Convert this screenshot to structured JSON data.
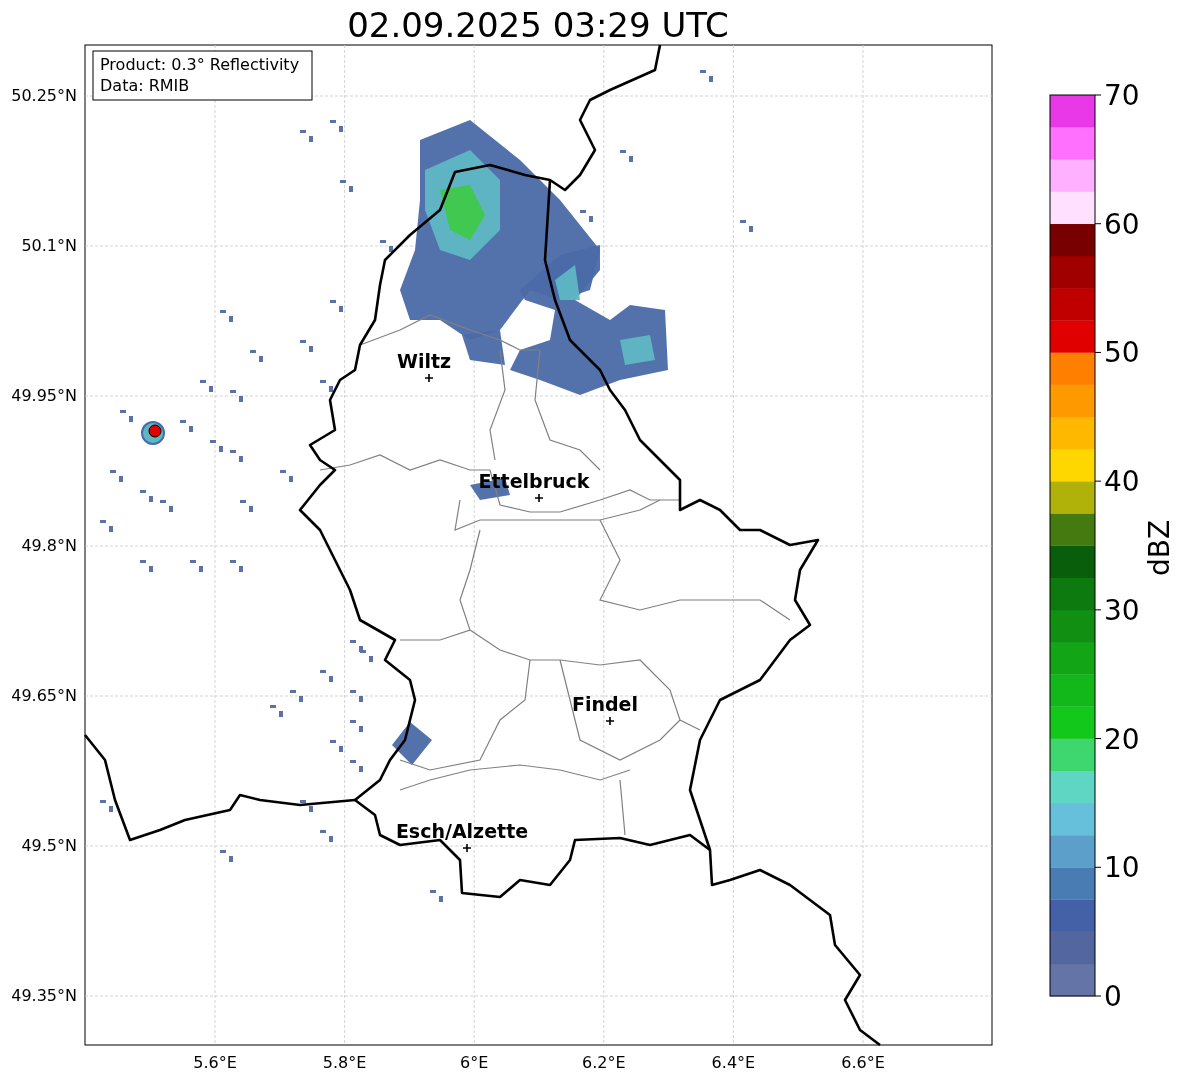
{
  "title": "02.09.2025 03:29 UTC",
  "info_box": [
    "Product: 0.3° Reflectivity",
    "Data: RMIB"
  ],
  "map": {
    "y_ticks": [
      "50.25°N",
      "50.1°N",
      "49.95°N",
      "49.8°N",
      "49.65°N",
      "49.5°N",
      "49.35°N"
    ],
    "x_ticks": [
      "5.6°E",
      "5.8°E",
      "6°E",
      "6.2°E",
      "6.4°E",
      "6.6°E"
    ],
    "cities": [
      {
        "name": "Wiltz"
      },
      {
        "name": "Ettelbruck"
      },
      {
        "name": "Findel"
      },
      {
        "name": "Esch/Alzette"
      }
    ]
  },
  "colorbar": {
    "label": "dBZ",
    "ticks": [
      "70",
      "60",
      "50",
      "40",
      "30",
      "20",
      "10",
      "0"
    ],
    "bands": [
      {
        "color": "#6474a6"
      },
      {
        "color": "#5366a0"
      },
      {
        "color": "#4460a6"
      },
      {
        "color": "#4a7cb4"
      },
      {
        "color": "#5b9fca"
      },
      {
        "color": "#66c0dc"
      },
      {
        "color": "#5fd6c4"
      },
      {
        "color": "#3ed66e"
      },
      {
        "color": "#12c81a"
      },
      {
        "color": "#12b81a"
      },
      {
        "color": "#12a516"
      },
      {
        "color": "#108f12"
      },
      {
        "color": "#0c7a0e"
      },
      {
        "color": "#085e0a"
      },
      {
        "color": "#447a10"
      },
      {
        "color": "#b0b20a"
      },
      {
        "color": "#ffd700"
      },
      {
        "color": "#ffb800"
      },
      {
        "color": "#ff9900"
      },
      {
        "color": "#ff7f00"
      },
      {
        "color": "#e00000"
      },
      {
        "color": "#c00000"
      },
      {
        "color": "#a00000"
      },
      {
        "color": "#780000"
      },
      {
        "color": "#ffe0ff"
      },
      {
        "color": "#ffb0ff"
      },
      {
        "color": "#ff70ff"
      },
      {
        "color": "#e838e8"
      }
    ]
  }
}
